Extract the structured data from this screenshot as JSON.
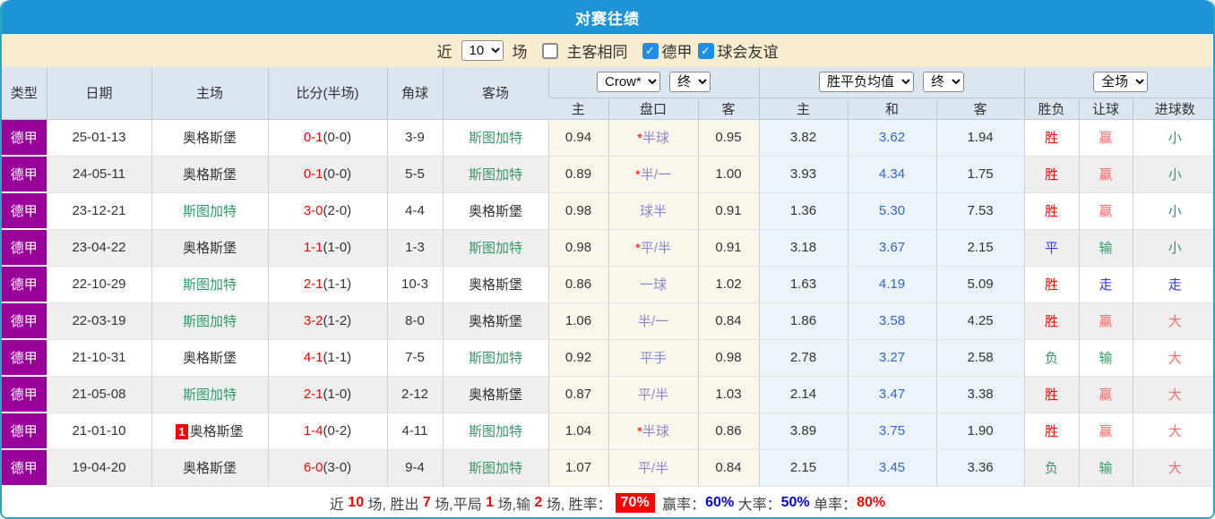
{
  "title": "对赛往绩",
  "colors": {
    "titlebar_blue": "#1E93D6",
    "panel_border_teal": "#2AA5C5",
    "filter_bg_cream": "#F8EDD0",
    "header_bg": "#DCE6F1",
    "type_purple": "#990099",
    "odds_col_cream": "#FBF6EC",
    "avg_col_blue": "#EBF4F9",
    "win_red": "#FF0000",
    "covered_pink": "#FB6A6A",
    "lose_green": "#339966",
    "draw_blue": "#3333FF",
    "handicap_violet": "#8888CC",
    "avg_draw_blue": "#3366CC",
    "checkbox_blue": "#1D8FE8"
  },
  "filter": {
    "near_label": "近",
    "count_value": "10",
    "matches_label": "场",
    "same_venue_label": "主客相同",
    "same_venue_checked": false,
    "league_label": "德甲",
    "league_checked": true,
    "friendly_label": "球会友谊",
    "friendly_checked": true
  },
  "table": {
    "selects": {
      "provider": "Crow*",
      "provider_time": "终",
      "avg_type": "胜平负均值",
      "avg_time": "终",
      "scope": "全场"
    },
    "headers": {
      "type": "类型",
      "date": "日期",
      "home": "主场",
      "score": "比分(半场)",
      "corner": "角球",
      "away": "客场",
      "odds_home": "主",
      "odds_handicap": "盘口",
      "odds_away": "客",
      "avg_home": "主",
      "avg_draw": "和",
      "avg_away": "客",
      "result": "胜负",
      "handicap_result": "让球",
      "goals_result": "进球数"
    },
    "rows": [
      {
        "league": "德甲",
        "date": "25-01-13",
        "badge": "",
        "home": "奥格斯堡",
        "home_style": "dark",
        "score": "0-1",
        "half": "(0-0)",
        "corner": "3-9",
        "away": "斯图加特",
        "away_style": "green",
        "crow_home": "0.94",
        "star": "*",
        "handicap": "半球",
        "crow_away": "0.95",
        "avg_home": "3.82",
        "avg_draw": "3.62",
        "avg_away": "1.94",
        "result": "胜",
        "result_style": "red",
        "hr": "赢",
        "hr_style": "pink",
        "gr": "小",
        "gr_style": "green"
      },
      {
        "league": "德甲",
        "date": "24-05-11",
        "badge": "",
        "home": "奥格斯堡",
        "home_style": "dark",
        "score": "0-1",
        "half": "(0-0)",
        "corner": "5-5",
        "away": "斯图加特",
        "away_style": "green",
        "crow_home": "0.89",
        "star": "*",
        "handicap": "半/一",
        "crow_away": "1.00",
        "avg_home": "3.93",
        "avg_draw": "4.34",
        "avg_away": "1.75",
        "result": "胜",
        "result_style": "red",
        "hr": "赢",
        "hr_style": "pink",
        "gr": "小",
        "gr_style": "green"
      },
      {
        "league": "德甲",
        "date": "23-12-21",
        "badge": "",
        "home": "斯图加特",
        "home_style": "green",
        "score": "3-0",
        "half": "(2-0)",
        "corner": "4-4",
        "away": "奥格斯堡",
        "away_style": "dark",
        "crow_home": "0.98",
        "star": "",
        "handicap": "球半",
        "crow_away": "0.91",
        "avg_home": "1.36",
        "avg_draw": "5.30",
        "avg_away": "7.53",
        "result": "胜",
        "result_style": "red",
        "hr": "赢",
        "hr_style": "pink",
        "gr": "小",
        "gr_style": "green"
      },
      {
        "league": "德甲",
        "date": "23-04-22",
        "badge": "",
        "home": "奥格斯堡",
        "home_style": "dark",
        "score": "1-1",
        "half": "(1-0)",
        "corner": "1-3",
        "away": "斯图加特",
        "away_style": "green",
        "crow_home": "0.98",
        "star": "*",
        "handicap": "平/半",
        "crow_away": "0.91",
        "avg_home": "3.18",
        "avg_draw": "3.67",
        "avg_away": "2.15",
        "result": "平",
        "result_style": "blue",
        "hr": "输",
        "hr_style": "green",
        "gr": "小",
        "gr_style": "green"
      },
      {
        "league": "德甲",
        "date": "22-10-29",
        "badge": "",
        "home": "斯图加特",
        "home_style": "green",
        "score": "2-1",
        "half": "(1-1)",
        "corner": "10-3",
        "away": "奥格斯堡",
        "away_style": "dark",
        "crow_home": "0.86",
        "star": "",
        "handicap": "一球",
        "crow_away": "1.02",
        "avg_home": "1.63",
        "avg_draw": "4.19",
        "avg_away": "5.09",
        "result": "胜",
        "result_style": "red",
        "hr": "走",
        "hr_style": "blue",
        "gr": "走",
        "gr_style": "blue"
      },
      {
        "league": "德甲",
        "date": "22-03-19",
        "badge": "",
        "home": "斯图加特",
        "home_style": "green",
        "score": "3-2",
        "half": "(1-2)",
        "corner": "8-0",
        "away": "奥格斯堡",
        "away_style": "dark",
        "crow_home": "1.06",
        "star": "",
        "handicap": "半/一",
        "crow_away": "0.84",
        "avg_home": "1.86",
        "avg_draw": "3.58",
        "avg_away": "4.25",
        "result": "胜",
        "result_style": "red",
        "hr": "赢",
        "hr_style": "pink",
        "gr": "大",
        "gr_style": "pink"
      },
      {
        "league": "德甲",
        "date": "21-10-31",
        "badge": "",
        "home": "奥格斯堡",
        "home_style": "dark",
        "score": "4-1",
        "half": "(1-1)",
        "corner": "7-5",
        "away": "斯图加特",
        "away_style": "green",
        "crow_home": "0.92",
        "star": "",
        "handicap": "平手",
        "crow_away": "0.98",
        "avg_home": "2.78",
        "avg_draw": "3.27",
        "avg_away": "2.58",
        "result": "负",
        "result_style": "green",
        "hr": "输",
        "hr_style": "green",
        "gr": "大",
        "gr_style": "pink"
      },
      {
        "league": "德甲",
        "date": "21-05-08",
        "badge": "",
        "home": "斯图加特",
        "home_style": "green",
        "score": "2-1",
        "half": "(1-0)",
        "corner": "2-12",
        "away": "奥格斯堡",
        "away_style": "dark",
        "crow_home": "0.87",
        "star": "",
        "handicap": "平/半",
        "crow_away": "1.03",
        "avg_home": "2.14",
        "avg_draw": "3.47",
        "avg_away": "3.38",
        "result": "胜",
        "result_style": "red",
        "hr": "赢",
        "hr_style": "pink",
        "gr": "大",
        "gr_style": "pink"
      },
      {
        "league": "德甲",
        "date": "21-01-10",
        "badge": "1",
        "home": "奥格斯堡",
        "home_style": "dark",
        "score": "1-4",
        "half": "(0-2)",
        "corner": "4-11",
        "away": "斯图加特",
        "away_style": "green",
        "crow_home": "1.04",
        "star": "*",
        "handicap": "半球",
        "crow_away": "0.86",
        "avg_home": "3.89",
        "avg_draw": "3.75",
        "avg_away": "1.90",
        "result": "胜",
        "result_style": "red",
        "hr": "赢",
        "hr_style": "pink",
        "gr": "大",
        "gr_style": "pink"
      },
      {
        "league": "德甲",
        "date": "19-04-20",
        "badge": "",
        "home": "奥格斯堡",
        "home_style": "dark",
        "score": "6-0",
        "half": "(3-0)",
        "corner": "9-4",
        "away": "斯图加特",
        "away_style": "green",
        "crow_home": "1.07",
        "star": "",
        "handicap": "平/半",
        "crow_away": "0.84",
        "avg_home": "2.15",
        "avg_draw": "3.45",
        "avg_away": "3.36",
        "result": "负",
        "result_style": "green",
        "hr": "输",
        "hr_style": "green",
        "gr": "大",
        "gr_style": "pink"
      }
    ]
  },
  "summary": {
    "segments": [
      {
        "t": "近 ",
        "c": "dim"
      },
      {
        "t": "10",
        "c": "red"
      },
      {
        "t": " 场, 胜出 ",
        "c": "dim"
      },
      {
        "t": "7",
        "c": "red"
      },
      {
        "t": " 场,平局 ",
        "c": "dim"
      },
      {
        "t": "1",
        "c": "red"
      },
      {
        "t": " 场,输 ",
        "c": "dim"
      },
      {
        "t": "2",
        "c": "red"
      },
      {
        "t": " 场, 胜率：",
        "c": "dim"
      },
      {
        "t": "70%",
        "c": "badge"
      },
      {
        "t": " 赢率：",
        "c": "dim"
      },
      {
        "t": "60%",
        "c": "blue"
      },
      {
        "t": " 大率：",
        "c": "dim"
      },
      {
        "t": "50%",
        "c": "blue"
      },
      {
        "t": " 单率：",
        "c": "dim"
      },
      {
        "t": "80%",
        "c": "red"
      }
    ]
  }
}
